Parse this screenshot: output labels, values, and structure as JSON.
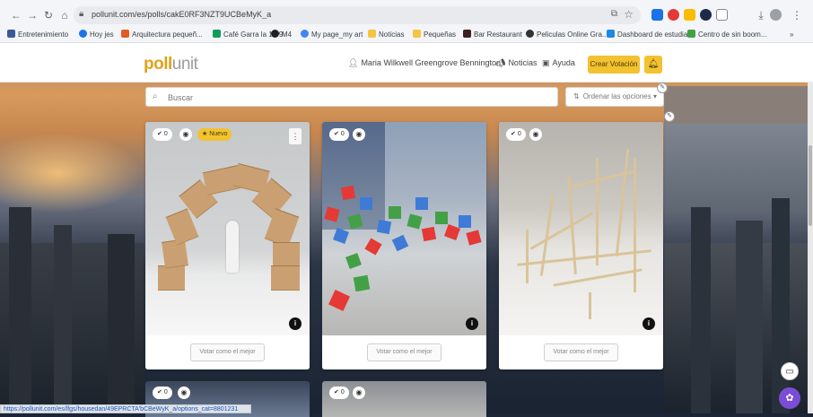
{
  "browser": {
    "url": "pollunit.com/es/polls/cakE0RF3NZT9UCBeMyK_a",
    "bookmarks": [
      "Entretenimiento",
      "Hoy jes",
      "Arquitectura pequeñ...",
      "Café Garra la 1-99",
      "M4",
      "My page_my art",
      "Noticias",
      "Pequeñas",
      "Bar Restaurant",
      "Peliculas Online Gra...",
      "Dashboard de estudia...",
      "Centro de sin boom..."
    ],
    "status_url": "https://pollunit.com/es/lfgs/housedan/49EPRCTA'bCBeWyK_a/options_cat=8801231"
  },
  "app": {
    "logo_main": "poll",
    "logo_sub": "unit",
    "user_name": "Maria Wilkwell Greengrove Bennington",
    "news_label": "Noticias",
    "help_label": "Ayuda",
    "create_button": "Crear Votación",
    "bell_icon": "bell-icon"
  },
  "search": {
    "placeholder": "Buscar",
    "sort_label": "Ordenar las opciones"
  },
  "cards": [
    {
      "votes": "0",
      "badge": "Nuevo",
      "vote_button": "Votar como el mejor"
    },
    {
      "votes": "0",
      "vote_button": "Votar como el mejor"
    },
    {
      "votes": "0",
      "vote_button": "Votar como el mejor"
    }
  ],
  "lower_cards": [
    {
      "votes": "0"
    },
    {
      "votes": "0"
    }
  ],
  "colors": {
    "accent": "#f2c230",
    "logo_yellow": "#e0a11b"
  }
}
